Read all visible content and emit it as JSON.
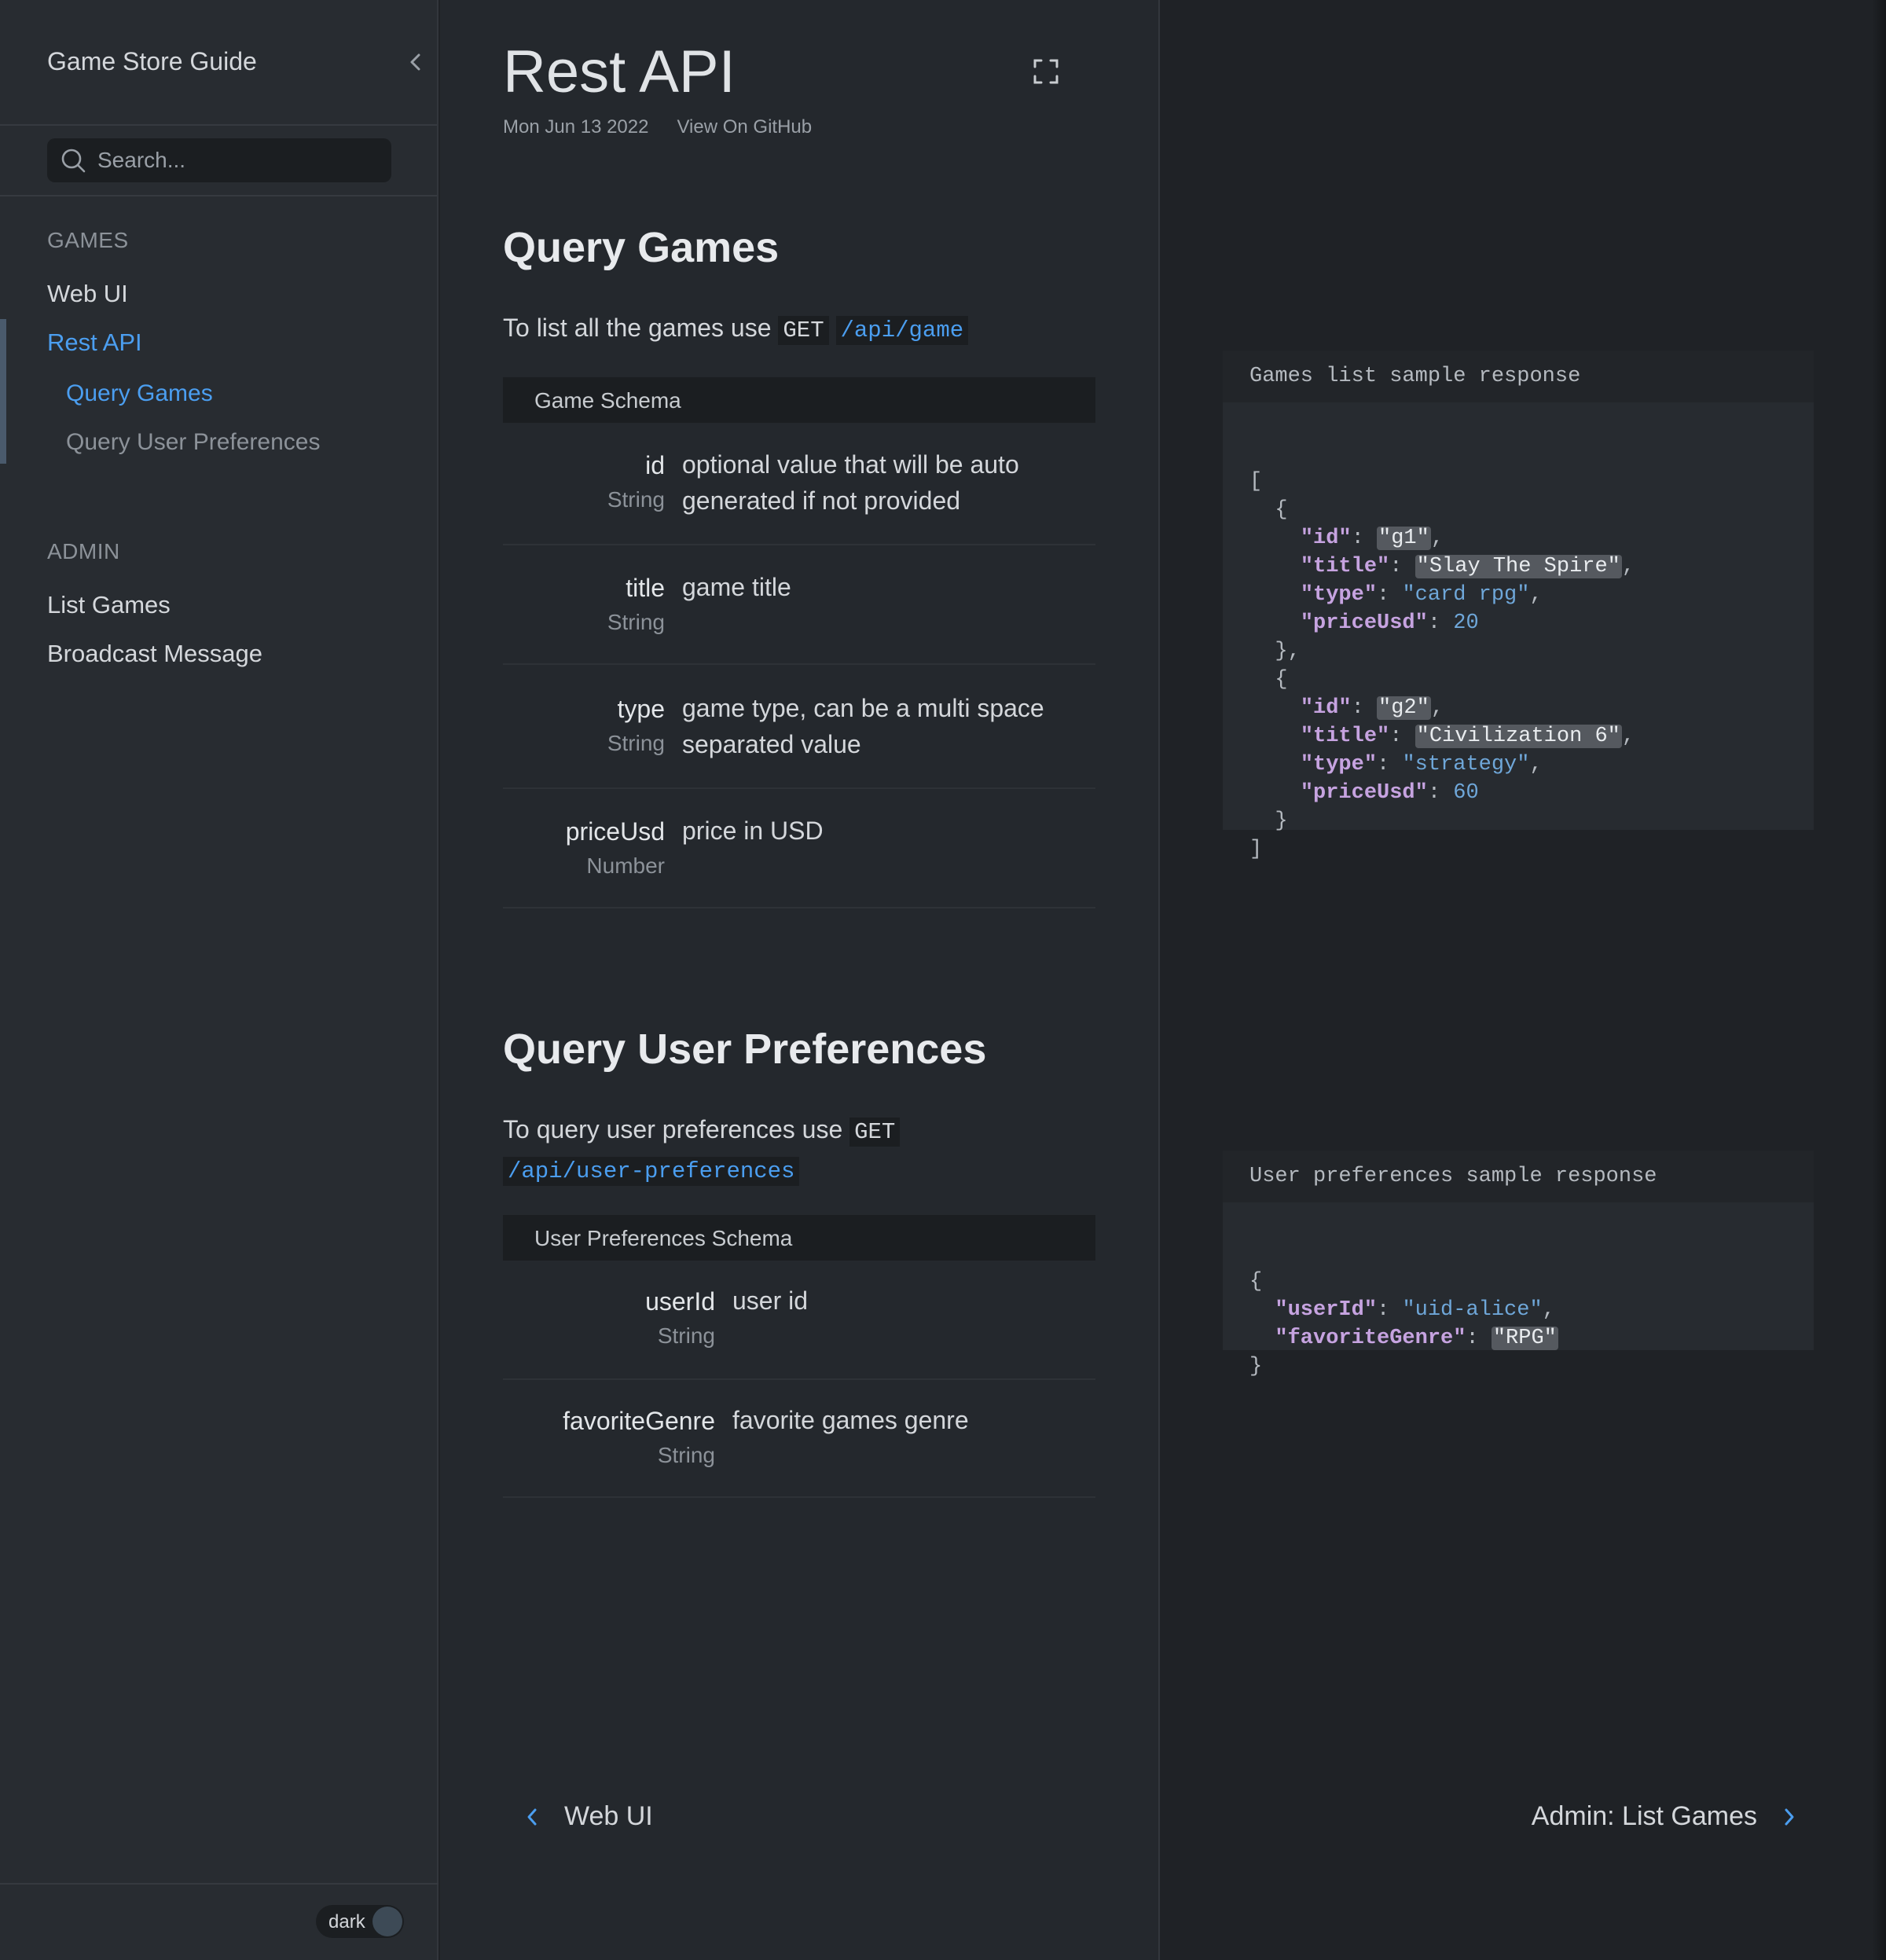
{
  "sidebar": {
    "title": "Game Store Guide",
    "search_placeholder": "Search...",
    "groups": [
      {
        "heading": "GAMES",
        "items": [
          "Web UI",
          "Rest API"
        ]
      },
      {
        "heading": "ADMIN",
        "items": [
          "List Games",
          "Broadcast Message"
        ]
      }
    ],
    "sub_items": [
      "Query Games",
      "Query User Preferences"
    ],
    "theme_label": "dark"
  },
  "page": {
    "title": "Rest API",
    "date": "Mon Jun 13 2022",
    "github_link": "View On GitHub"
  },
  "section1": {
    "heading": "Query Games",
    "intro": "To list all the games use",
    "method": "GET",
    "path": "/api/game",
    "schema_title": "Game Schema",
    "fields": [
      {
        "name": "id",
        "type": "String",
        "desc": "optional value that will be auto generated if not provided"
      },
      {
        "name": "title",
        "type": "String",
        "desc": "game title"
      },
      {
        "name": "type",
        "type": "String",
        "desc": "game type, can be a multi space separated value"
      },
      {
        "name": "priceUsd",
        "type": "Number",
        "desc": "price in USD"
      }
    ]
  },
  "section2": {
    "heading": "Query User Preferences",
    "intro": "To query user preferences use",
    "method": "GET",
    "path": "/api/user-preferences",
    "schema_title": "User Preferences Schema",
    "fields": [
      {
        "name": "userId",
        "type": "String",
        "desc": "user id"
      },
      {
        "name": "favoriteGenre",
        "type": "String",
        "desc": "favorite games genre"
      }
    ]
  },
  "code1": {
    "caption": "Games list sample response",
    "games": [
      {
        "id": "\"g1\"",
        "title": "\"Slay The Spire\"",
        "type": "\"card rpg\"",
        "priceUsd": "20"
      },
      {
        "id": "\"g2\"",
        "title": "\"Civilization 6\"",
        "type": "\"strategy\"",
        "priceUsd": "60"
      }
    ]
  },
  "code2": {
    "caption": "User preferences sample response",
    "userId": "\"uid-alice\"",
    "favoriteGenre": "\"RPG\""
  },
  "pager": {
    "prev": "Web UI",
    "next": "Admin: List Games"
  },
  "colors": {
    "accent": "#4b9ef0",
    "key": "#c6a3e0",
    "string": "#6fa7d9"
  }
}
